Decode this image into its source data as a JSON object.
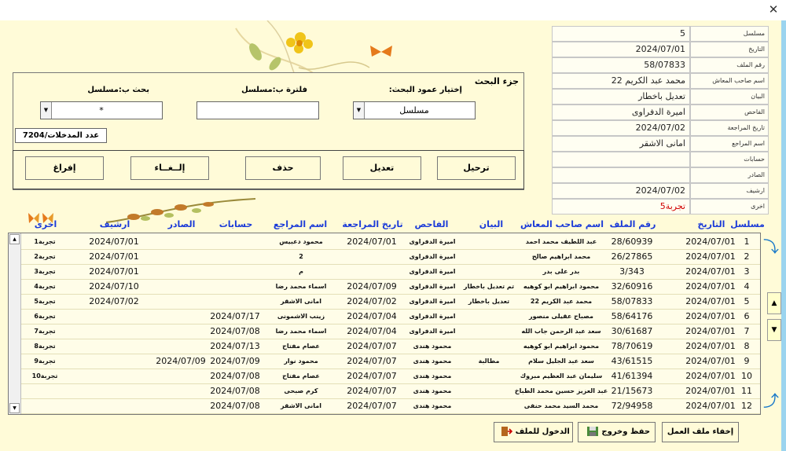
{
  "window": {
    "close_label": "✕"
  },
  "info": [
    {
      "label": "مسلسل",
      "value": "5"
    },
    {
      "label": "التاريخ",
      "value": "2024/07/01"
    },
    {
      "label": "رقم الملف",
      "value": "58/07833"
    },
    {
      "label": "اسم صاحب المعاش",
      "value": "محمد عبد الكريم 22"
    },
    {
      "label": "البيان",
      "value": "تعديل باخطار"
    },
    {
      "label": "الفاحص",
      "value": "اميرة الدفراوى"
    },
    {
      "label": "تاريخ المراجعة",
      "value": "2024/07/02"
    },
    {
      "label": "اسم المراجع",
      "value": "امانى الاشقر"
    },
    {
      "label": "حسابات",
      "value": ""
    },
    {
      "label": "الصادر",
      "value": ""
    },
    {
      "label": "ارشيف",
      "value": "2024/07/02"
    },
    {
      "label": "اخرى",
      "value": "تجربة5"
    }
  ],
  "search": {
    "title": "جزء البحث",
    "column_label": "إختيار عمود البحث:",
    "column_value": "مسلسل",
    "filter_label": "فلترة ب:مسلسل",
    "filter_value": "",
    "search_label": "بحث ب:مسلسل",
    "search_value": "*",
    "count_label": "عدد المدخلات/7204"
  },
  "actions": {
    "post": "ترحيل",
    "edit": "تعديل",
    "delete": "حذف",
    "cancel": "إلــغــاء",
    "clear": "إفراغ"
  },
  "columns": [
    "مسلسل",
    "التاريخ",
    "رقم الملف",
    "اسم صاحب المعاش",
    "البيان",
    "الفاحص",
    "تاريخ المراجعة",
    "اسم المراجع",
    "حسابات",
    "الصادر",
    "ارشيف",
    "اخرى"
  ],
  "rows": [
    [
      "1",
      "2024/07/01",
      "28/60939",
      "عبد اللطيف محمد احمد",
      "",
      "اميرة الدفراوى",
      "2024/07/01",
      "محمود دعبيس",
      "",
      "",
      "2024/07/01",
      "تجربة1"
    ],
    [
      "2",
      "2024/07/01",
      "26/27865",
      "محمد ابراهيم صالح",
      "",
      "اميرة الدفراوى",
      "",
      "2",
      "",
      "",
      "2024/07/01",
      "تجربة2"
    ],
    [
      "3",
      "2024/07/01",
      "3/343",
      "بدر على بدر",
      "",
      "اميرة الدفراوى",
      "",
      "م",
      "",
      "",
      "2024/07/01",
      "تجربة3"
    ],
    [
      "4",
      "2024/07/01",
      "32/60916",
      "محمود ابراهيم ابو كوهيه",
      "تم تعديل باخطار",
      "اميرة الدفراوى",
      "2024/07/09",
      "اسماء محمد رضا",
      "",
      "",
      "2024/07/10",
      "تجربة4"
    ],
    [
      "5",
      "2024/07/01",
      "58/07833",
      "محمد عبد الكريم 22",
      "تعديل باخطار",
      "اميرة الدفراوى",
      "2024/07/02",
      "امانى الاشقر",
      "",
      "",
      "2024/07/02",
      "تجربة5"
    ],
    [
      "6",
      "2024/07/01",
      "58/64176",
      "مصباح عقيلى منصور",
      "",
      "اميرة الدفراوى",
      "2024/07/04",
      "زينب الاشمونى",
      "2024/07/17",
      "",
      "",
      "تجربة6"
    ],
    [
      "7",
      "2024/07/01",
      "30/61687",
      "سعد عبد الرحمن جاب الله",
      "",
      "اميرة الدفراوى",
      "2024/07/04",
      "اسماء محمد رضا",
      "2024/07/08",
      "",
      "",
      "تجربة7"
    ],
    [
      "8",
      "2024/07/01",
      "78/70619",
      "محمود ابراهيم ابو كوهيه",
      "",
      "محمود هندى",
      "2024/07/07",
      "عصام مفتاح",
      "2024/07/13",
      "",
      "",
      "تجربة8"
    ],
    [
      "9",
      "2024/07/01",
      "43/61515",
      "سعد عبد الجليل سلام",
      "مطالبة",
      "محمود هندى",
      "2024/07/07",
      "محمود نوار",
      "2024/07/09",
      "2024/07/09",
      "",
      "تجربة9"
    ],
    [
      "10",
      "2024/07/01",
      "41/61394",
      "سليمان عبد العظيم مبروك",
      "",
      "محمود هندى",
      "2024/07/07",
      "عصام مفتاح",
      "2024/07/08",
      "",
      "",
      "تجربة10"
    ],
    [
      "11",
      "2024/07/01",
      "21/15673",
      "عبد العزيز حسين محمد الطباخ",
      "",
      "محمود هندى",
      "2024/07/07",
      "كرم صبحى",
      "2024/07/08",
      "",
      "",
      ""
    ],
    [
      "12",
      "2024/07/01",
      "72/94958",
      "محمد السيد محمد حنفى",
      "",
      "محمود هندى",
      "2024/07/07",
      "امانى الاشقر",
      "2024/07/08",
      "",
      "",
      ""
    ]
  ],
  "bottom": {
    "hide": "إخفاء ملف العمل",
    "save_exit": "حفظ وخروج",
    "enter_file": "الدخول للملف"
  },
  "colors": {
    "header_text": "#1a3ad8",
    "background": "#fffbd8",
    "other_value": "#d10000"
  }
}
